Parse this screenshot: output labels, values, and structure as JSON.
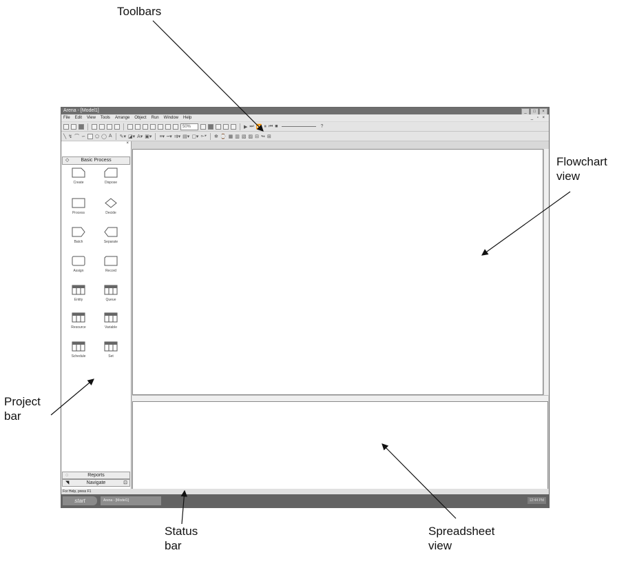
{
  "callouts": {
    "toolbars": "Toolbars",
    "flowchart": [
      "Flowchart",
      "view"
    ],
    "project": [
      "Project",
      "bar"
    ],
    "status": [
      "Status",
      "bar"
    ],
    "spreadsheet": [
      "Spreadsheet",
      "view"
    ]
  },
  "window": {
    "title": "Arena - [Model1]",
    "menus": [
      "File",
      "Edit",
      "View",
      "Tools",
      "Arrange",
      "Object",
      "Run",
      "Window",
      "Help"
    ],
    "zoom": "50%"
  },
  "project_bar": {
    "panel": "Basic Process",
    "modules": [
      "Create",
      "Dispose",
      "Process",
      "Decide",
      "Batch",
      "Separate",
      "Assign",
      "Record",
      "Entity",
      "Queue",
      "Resource",
      "Variable",
      "Schedule",
      "Set"
    ],
    "footer": [
      "Reports",
      "Navigate"
    ]
  },
  "status_text": "For Help, press F1",
  "taskbar": {
    "start": "start",
    "item": "Arena - [Model1]",
    "clock": "12:44 PM"
  },
  "colors": {
    "titlebar": "#6e6e6e",
    "taskbar": "#636363",
    "chrome": "#d8d8d8"
  }
}
